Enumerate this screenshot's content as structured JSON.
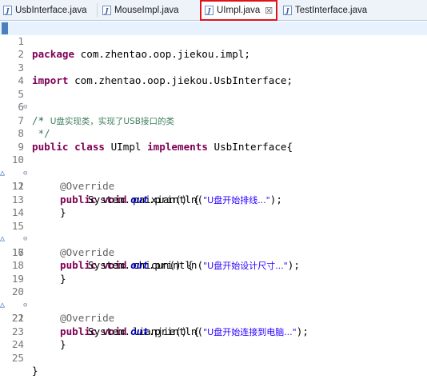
{
  "tabs": [
    {
      "label": "UsbInterface.java",
      "icon": "java-file-icon"
    },
    {
      "label": "MouseImpl.java",
      "icon": "java-file-icon"
    },
    {
      "label": "UImpl.java",
      "icon": "java-file-icon",
      "active": true,
      "close": "☒"
    },
    {
      "label": "TestInterface.java",
      "icon": "java-file-icon"
    }
  ],
  "icon_glyph": "J",
  "colors": {
    "keyword": "#7f0055",
    "comment": "#3f7f5f",
    "annotation": "#646464",
    "string": "#2a00ff",
    "field": "#0000c0",
    "highlight_border": "#e0121b"
  },
  "code": {
    "l1": {
      "n": "1",
      "kw": "package",
      "rest": " com.zhentao.oop.jiekou.impl;"
    },
    "l2": {
      "n": "2"
    },
    "l3": {
      "n": "3",
      "kw": "import",
      "rest": " com.zhentao.oop.jiekou.UsbInterface;"
    },
    "l4": {
      "n": "4"
    },
    "l5": {
      "n": "5",
      "text": "/*"
    },
    "l6": {
      "n": "6",
      "pre": " * ",
      "cn": "U盘实现类，实现了USB接口的类"
    },
    "l7": {
      "n": "7",
      "text": " */"
    },
    "l8": {
      "n": "8",
      "kw1": "public",
      "kw2": "class",
      "name": " UImpl ",
      "kw3": "implements",
      "rest": " UsbInterface{"
    },
    "l9": {
      "n": "9"
    },
    "l10": {
      "n": "10",
      "ann": "@Override"
    },
    "l11": {
      "n": "11",
      "kw1": "public",
      "kw2": "void",
      "rest": " paixian() {"
    },
    "l12": {
      "n": "12",
      "pre": "System.",
      "fld": "out",
      "mid": ".println(",
      "str": "\"U盘开始排线...\"",
      "post": ");"
    },
    "l13": {
      "n": "13",
      "text": "}"
    },
    "l14": {
      "n": "14"
    },
    "l15": {
      "n": "15",
      "ann": "@Override"
    },
    "l16": {
      "n": "16",
      "kw1": "public",
      "kw2": "void",
      "rest": " chicun() {"
    },
    "l17": {
      "n": "17",
      "pre": "System.",
      "fld": "out",
      "mid": ".println(",
      "str": "\"U盘开始设计尺寸...\"",
      "post": ");"
    },
    "l18": {
      "n": "18",
      "text": "}"
    },
    "l19": {
      "n": "19"
    },
    "l20": {
      "n": "20",
      "ann": "@Override"
    },
    "l21": {
      "n": "21",
      "kw1": "public",
      "kw2": "void",
      "rest": " lianjie() {"
    },
    "l22": {
      "n": "22",
      "pre": "System.",
      "fld": "out",
      "mid": ".println(",
      "str": "\"U盘开始连接到电脑...\"",
      "post": ");"
    },
    "l23": {
      "n": "23",
      "text": "}"
    },
    "l24": {
      "n": "24"
    },
    "l25": {
      "n": "25",
      "text": "}"
    }
  },
  "markers": {
    "fold": "⊖",
    "override": "△"
  }
}
